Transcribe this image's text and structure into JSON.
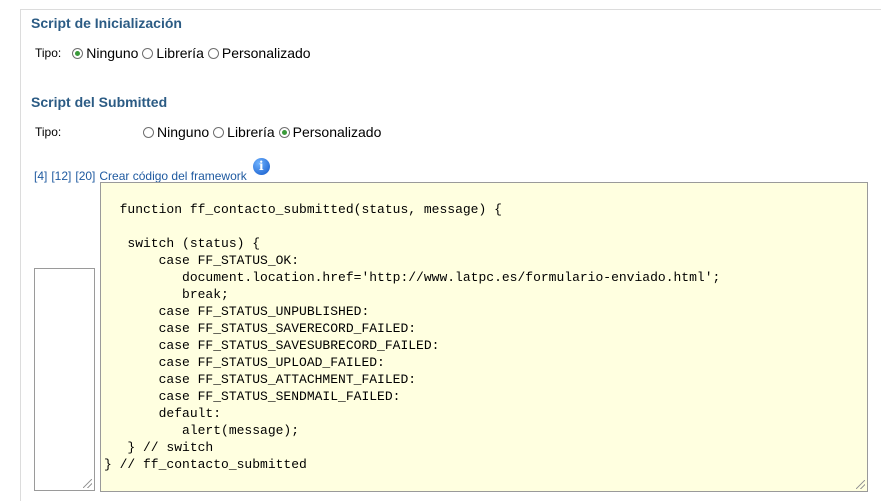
{
  "init_section": {
    "title": "Script de Inicialización",
    "tipo_label": "Tipo:",
    "options": [
      "Ninguno",
      "Librería",
      "Personalizado"
    ],
    "selected": "Ninguno"
  },
  "submitted_section": {
    "title": "Script del Submitted",
    "tipo_label": "Tipo:",
    "options": [
      "Ninguno",
      "Librería",
      "Personalizado"
    ],
    "selected": "Personalizado"
  },
  "links": {
    "size_4": "[4]",
    "size_12": "[12]",
    "size_20": "[20]",
    "create_code": "Crear código del framework"
  },
  "editor": {
    "code": "function ff_contacto_submitted(status, message) {\n\n   switch (status) {\n       case FF_STATUS_OK:\n          document.location.href='http://www.latpc.es/formulario-enviado.html';\n          break;\n       case FF_STATUS_UNPUBLISHED:\n       case FF_STATUS_SAVERECORD_FAILED:\n       case FF_STATUS_SAVESUBRECORD_FAILED:\n       case FF_STATUS_UPLOAD_FAILED:\n       case FF_STATUS_ATTACHMENT_FAILED:\n       case FF_STATUS_SENDMAIL_FAILED:\n       default:\n          alert(message);\n   } // switch\n} // ff_contacto_submitted"
  },
  "icons": {
    "info": "info-icon"
  },
  "colors": {
    "section_title": "#2b5b84",
    "link": "#1f5aa0",
    "editor_bg": "#ffffe0",
    "radio_checked": "#3a9a3a"
  }
}
